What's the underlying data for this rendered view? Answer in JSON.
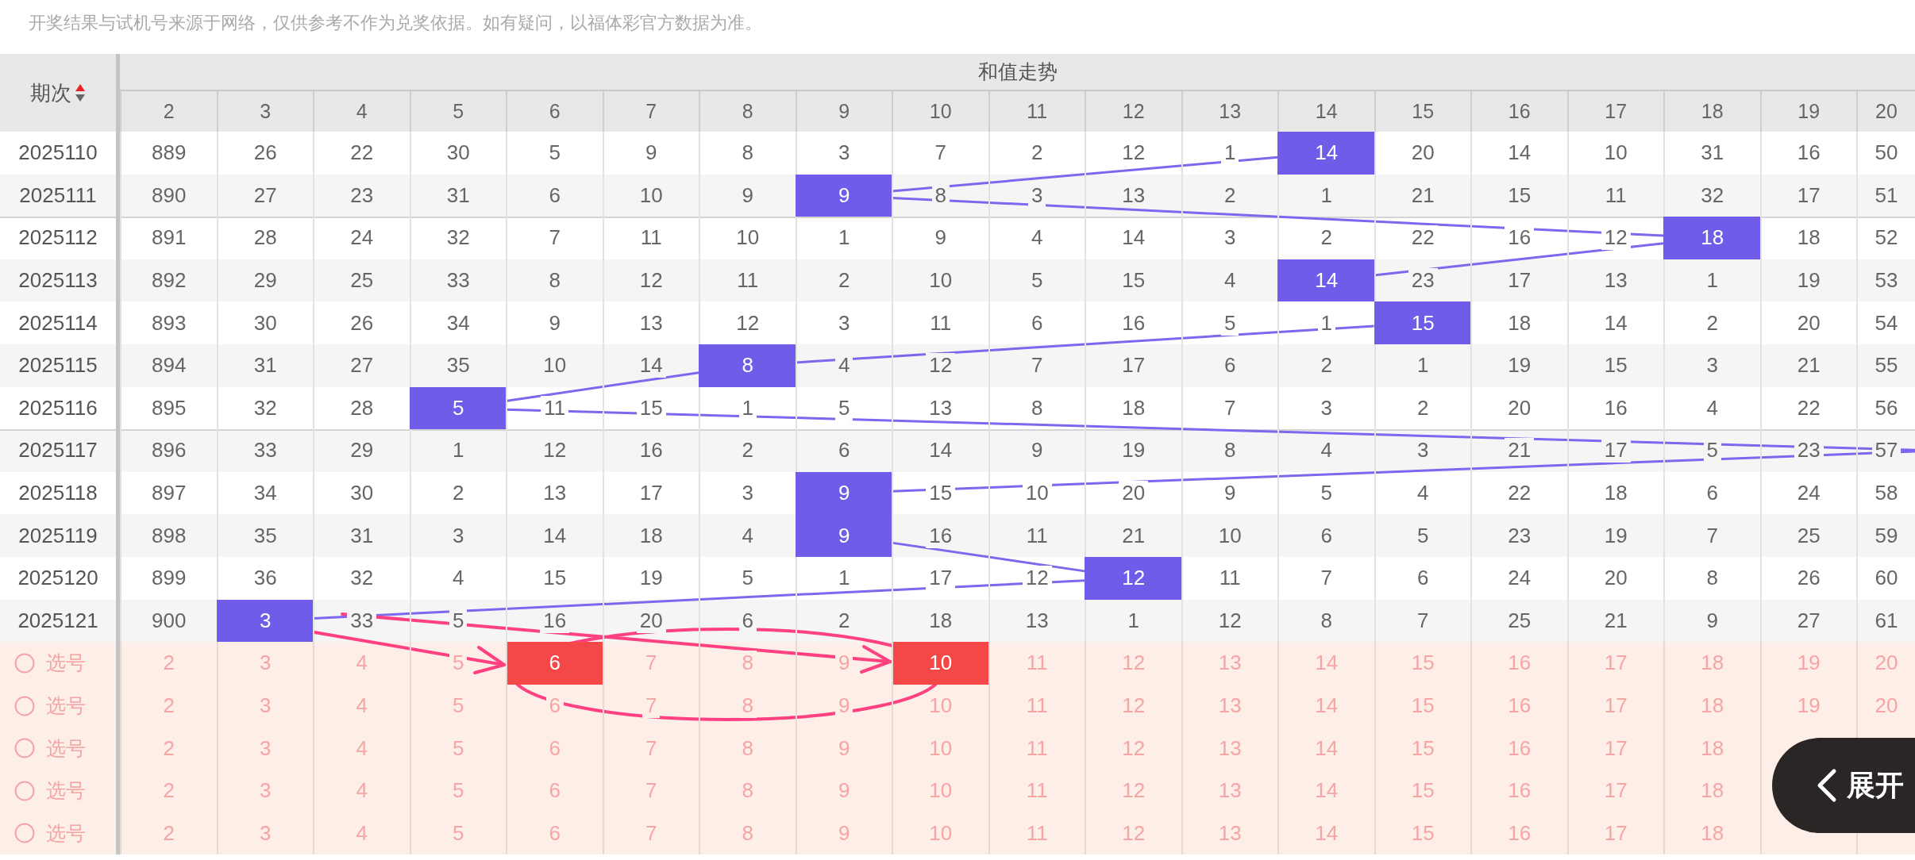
{
  "notice": "开奖结果与试机号来源于网络，仅供参考不作为兑奖依据。如有疑问，以福体彩官方数据为准。",
  "table": {
    "period_header": "期次",
    "sort_ascending": true,
    "group_header": "和值走势",
    "columns": [
      "2",
      "3",
      "4",
      "5",
      "6",
      "7",
      "8",
      "9",
      "10",
      "11",
      "12",
      "13",
      "14",
      "15",
      "16",
      "17",
      "18",
      "19",
      "20"
    ],
    "rows": [
      {
        "period": "2025110",
        "divider_above": false,
        "cells": [
          {
            "text": "889",
            "hit": false
          },
          {
            "text": "26",
            "hit": false
          },
          {
            "text": "22",
            "hit": false
          },
          {
            "text": "30",
            "hit": false
          },
          {
            "text": "5",
            "hit": false
          },
          {
            "text": "9",
            "hit": false
          },
          {
            "text": "8",
            "hit": false
          },
          {
            "text": "3",
            "hit": false
          },
          {
            "text": "7",
            "hit": false
          },
          {
            "text": "2",
            "hit": false
          },
          {
            "text": "12",
            "hit": false
          },
          {
            "text": "1",
            "hit": false
          },
          {
            "text": "14",
            "hit": true
          },
          {
            "text": "20",
            "hit": false
          },
          {
            "text": "14",
            "hit": false
          },
          {
            "text": "10",
            "hit": false
          },
          {
            "text": "31",
            "hit": false
          },
          {
            "text": "16",
            "hit": false
          },
          {
            "text": "50",
            "hit": false
          }
        ]
      },
      {
        "period": "2025111",
        "divider_above": false,
        "cells": [
          {
            "text": "890",
            "hit": false
          },
          {
            "text": "27",
            "hit": false
          },
          {
            "text": "23",
            "hit": false
          },
          {
            "text": "31",
            "hit": false
          },
          {
            "text": "6",
            "hit": false
          },
          {
            "text": "10",
            "hit": false
          },
          {
            "text": "9",
            "hit": false
          },
          {
            "text": "9",
            "hit": true
          },
          {
            "text": "8",
            "hit": false
          },
          {
            "text": "3",
            "hit": false
          },
          {
            "text": "13",
            "hit": false
          },
          {
            "text": "2",
            "hit": false
          },
          {
            "text": "1",
            "hit": false
          },
          {
            "text": "21",
            "hit": false
          },
          {
            "text": "15",
            "hit": false
          },
          {
            "text": "11",
            "hit": false
          },
          {
            "text": "32",
            "hit": false
          },
          {
            "text": "17",
            "hit": false
          },
          {
            "text": "51",
            "hit": false
          }
        ]
      },
      {
        "period": "2025112",
        "divider_above": true,
        "cells": [
          {
            "text": "891",
            "hit": false
          },
          {
            "text": "28",
            "hit": false
          },
          {
            "text": "24",
            "hit": false
          },
          {
            "text": "32",
            "hit": false
          },
          {
            "text": "7",
            "hit": false
          },
          {
            "text": "11",
            "hit": false
          },
          {
            "text": "10",
            "hit": false
          },
          {
            "text": "1",
            "hit": false
          },
          {
            "text": "9",
            "hit": false
          },
          {
            "text": "4",
            "hit": false
          },
          {
            "text": "14",
            "hit": false
          },
          {
            "text": "3",
            "hit": false
          },
          {
            "text": "2",
            "hit": false
          },
          {
            "text": "22",
            "hit": false
          },
          {
            "text": "16",
            "hit": false
          },
          {
            "text": "12",
            "hit": false
          },
          {
            "text": "18",
            "hit": true
          },
          {
            "text": "18",
            "hit": false
          },
          {
            "text": "52",
            "hit": false
          }
        ]
      },
      {
        "period": "2025113",
        "divider_above": false,
        "cells": [
          {
            "text": "892",
            "hit": false
          },
          {
            "text": "29",
            "hit": false
          },
          {
            "text": "25",
            "hit": false
          },
          {
            "text": "33",
            "hit": false
          },
          {
            "text": "8",
            "hit": false
          },
          {
            "text": "12",
            "hit": false
          },
          {
            "text": "11",
            "hit": false
          },
          {
            "text": "2",
            "hit": false
          },
          {
            "text": "10",
            "hit": false
          },
          {
            "text": "5",
            "hit": false
          },
          {
            "text": "15",
            "hit": false
          },
          {
            "text": "4",
            "hit": false
          },
          {
            "text": "14",
            "hit": true
          },
          {
            "text": "23",
            "hit": false
          },
          {
            "text": "17",
            "hit": false
          },
          {
            "text": "13",
            "hit": false
          },
          {
            "text": "1",
            "hit": false
          },
          {
            "text": "19",
            "hit": false
          },
          {
            "text": "53",
            "hit": false
          }
        ]
      },
      {
        "period": "2025114",
        "divider_above": false,
        "cells": [
          {
            "text": "893",
            "hit": false
          },
          {
            "text": "30",
            "hit": false
          },
          {
            "text": "26",
            "hit": false
          },
          {
            "text": "34",
            "hit": false
          },
          {
            "text": "9",
            "hit": false
          },
          {
            "text": "13",
            "hit": false
          },
          {
            "text": "12",
            "hit": false
          },
          {
            "text": "3",
            "hit": false
          },
          {
            "text": "11",
            "hit": false
          },
          {
            "text": "6",
            "hit": false
          },
          {
            "text": "16",
            "hit": false
          },
          {
            "text": "5",
            "hit": false
          },
          {
            "text": "1",
            "hit": false
          },
          {
            "text": "15",
            "hit": true
          },
          {
            "text": "18",
            "hit": false
          },
          {
            "text": "14",
            "hit": false
          },
          {
            "text": "2",
            "hit": false
          },
          {
            "text": "20",
            "hit": false
          },
          {
            "text": "54",
            "hit": false
          }
        ]
      },
      {
        "period": "2025115",
        "divider_above": false,
        "cells": [
          {
            "text": "894",
            "hit": false
          },
          {
            "text": "31",
            "hit": false
          },
          {
            "text": "27",
            "hit": false
          },
          {
            "text": "35",
            "hit": false
          },
          {
            "text": "10",
            "hit": false
          },
          {
            "text": "14",
            "hit": false
          },
          {
            "text": "8",
            "hit": true
          },
          {
            "text": "4",
            "hit": false
          },
          {
            "text": "12",
            "hit": false
          },
          {
            "text": "7",
            "hit": false
          },
          {
            "text": "17",
            "hit": false
          },
          {
            "text": "6",
            "hit": false
          },
          {
            "text": "2",
            "hit": false
          },
          {
            "text": "1",
            "hit": false
          },
          {
            "text": "19",
            "hit": false
          },
          {
            "text": "15",
            "hit": false
          },
          {
            "text": "3",
            "hit": false
          },
          {
            "text": "21",
            "hit": false
          },
          {
            "text": "55",
            "hit": false
          }
        ]
      },
      {
        "period": "2025116",
        "divider_above": false,
        "cells": [
          {
            "text": "895",
            "hit": false
          },
          {
            "text": "32",
            "hit": false
          },
          {
            "text": "28",
            "hit": false
          },
          {
            "text": "5",
            "hit": true
          },
          {
            "text": "11",
            "hit": false
          },
          {
            "text": "15",
            "hit": false
          },
          {
            "text": "1",
            "hit": false
          },
          {
            "text": "5",
            "hit": false
          },
          {
            "text": "13",
            "hit": false
          },
          {
            "text": "8",
            "hit": false
          },
          {
            "text": "18",
            "hit": false
          },
          {
            "text": "7",
            "hit": false
          },
          {
            "text": "3",
            "hit": false
          },
          {
            "text": "2",
            "hit": false
          },
          {
            "text": "20",
            "hit": false
          },
          {
            "text": "16",
            "hit": false
          },
          {
            "text": "4",
            "hit": false
          },
          {
            "text": "22",
            "hit": false
          },
          {
            "text": "56",
            "hit": false
          }
        ]
      },
      {
        "period": "2025117",
        "divider_above": true,
        "cells": [
          {
            "text": "896",
            "hit": false
          },
          {
            "text": "33",
            "hit": false
          },
          {
            "text": "29",
            "hit": false
          },
          {
            "text": "1",
            "hit": false
          },
          {
            "text": "12",
            "hit": false
          },
          {
            "text": "16",
            "hit": false
          },
          {
            "text": "2",
            "hit": false
          },
          {
            "text": "6",
            "hit": false
          },
          {
            "text": "14",
            "hit": false
          },
          {
            "text": "9",
            "hit": false
          },
          {
            "text": "19",
            "hit": false
          },
          {
            "text": "8",
            "hit": false
          },
          {
            "text": "4",
            "hit": false
          },
          {
            "text": "3",
            "hit": false
          },
          {
            "text": "21",
            "hit": false
          },
          {
            "text": "17",
            "hit": false
          },
          {
            "text": "5",
            "hit": false
          },
          {
            "text": "23",
            "hit": false
          },
          {
            "text": "57",
            "hit": false
          }
        ]
      },
      {
        "period": "2025118",
        "divider_above": false,
        "cells": [
          {
            "text": "897",
            "hit": false
          },
          {
            "text": "34",
            "hit": false
          },
          {
            "text": "30",
            "hit": false
          },
          {
            "text": "2",
            "hit": false
          },
          {
            "text": "13",
            "hit": false
          },
          {
            "text": "17",
            "hit": false
          },
          {
            "text": "3",
            "hit": false
          },
          {
            "text": "9",
            "hit": true
          },
          {
            "text": "15",
            "hit": false
          },
          {
            "text": "10",
            "hit": false
          },
          {
            "text": "20",
            "hit": false
          },
          {
            "text": "9",
            "hit": false
          },
          {
            "text": "5",
            "hit": false
          },
          {
            "text": "4",
            "hit": false
          },
          {
            "text": "22",
            "hit": false
          },
          {
            "text": "18",
            "hit": false
          },
          {
            "text": "6",
            "hit": false
          },
          {
            "text": "24",
            "hit": false
          },
          {
            "text": "58",
            "hit": false
          }
        ]
      },
      {
        "period": "2025119",
        "divider_above": false,
        "cells": [
          {
            "text": "898",
            "hit": false
          },
          {
            "text": "35",
            "hit": false
          },
          {
            "text": "31",
            "hit": false
          },
          {
            "text": "3",
            "hit": false
          },
          {
            "text": "14",
            "hit": false
          },
          {
            "text": "18",
            "hit": false
          },
          {
            "text": "4",
            "hit": false
          },
          {
            "text": "9",
            "hit": true
          },
          {
            "text": "16",
            "hit": false
          },
          {
            "text": "11",
            "hit": false
          },
          {
            "text": "21",
            "hit": false
          },
          {
            "text": "10",
            "hit": false
          },
          {
            "text": "6",
            "hit": false
          },
          {
            "text": "5",
            "hit": false
          },
          {
            "text": "23",
            "hit": false
          },
          {
            "text": "19",
            "hit": false
          },
          {
            "text": "7",
            "hit": false
          },
          {
            "text": "25",
            "hit": false
          },
          {
            "text": "59",
            "hit": false
          }
        ]
      },
      {
        "period": "2025120",
        "divider_above": false,
        "cells": [
          {
            "text": "899",
            "hit": false
          },
          {
            "text": "36",
            "hit": false
          },
          {
            "text": "32",
            "hit": false
          },
          {
            "text": "4",
            "hit": false
          },
          {
            "text": "15",
            "hit": false
          },
          {
            "text": "19",
            "hit": false
          },
          {
            "text": "5",
            "hit": false
          },
          {
            "text": "1",
            "hit": false
          },
          {
            "text": "17",
            "hit": false
          },
          {
            "text": "12",
            "hit": false
          },
          {
            "text": "12",
            "hit": true
          },
          {
            "text": "11",
            "hit": false
          },
          {
            "text": "7",
            "hit": false
          },
          {
            "text": "6",
            "hit": false
          },
          {
            "text": "24",
            "hit": false
          },
          {
            "text": "20",
            "hit": false
          },
          {
            "text": "8",
            "hit": false
          },
          {
            "text": "26",
            "hit": false
          },
          {
            "text": "60",
            "hit": false
          }
        ]
      },
      {
        "period": "2025121",
        "divider_above": false,
        "cells": [
          {
            "text": "900",
            "hit": false
          },
          {
            "text": "3",
            "hit": true
          },
          {
            "text": "33",
            "hit": false
          },
          {
            "text": "5",
            "hit": false
          },
          {
            "text": "16",
            "hit": false
          },
          {
            "text": "20",
            "hit": false
          },
          {
            "text": "6",
            "hit": false
          },
          {
            "text": "2",
            "hit": false
          },
          {
            "text": "18",
            "hit": false
          },
          {
            "text": "13",
            "hit": false
          },
          {
            "text": "1",
            "hit": false
          },
          {
            "text": "12",
            "hit": false
          },
          {
            "text": "8",
            "hit": false
          },
          {
            "text": "7",
            "hit": false
          },
          {
            "text": "25",
            "hit": false
          },
          {
            "text": "21",
            "hit": false
          },
          {
            "text": "9",
            "hit": false
          },
          {
            "text": "27",
            "hit": false
          },
          {
            "text": "61",
            "hit": false
          }
        ]
      }
    ],
    "pick_rows": [
      {
        "label": "选号",
        "cells": [
          {
            "text": "2",
            "selected": false
          },
          {
            "text": "3",
            "selected": false
          },
          {
            "text": "4",
            "selected": false
          },
          {
            "text": "5",
            "selected": false
          },
          {
            "text": "6",
            "selected": true
          },
          {
            "text": "7",
            "selected": false
          },
          {
            "text": "8",
            "selected": false
          },
          {
            "text": "9",
            "selected": false
          },
          {
            "text": "10",
            "selected": true
          },
          {
            "text": "11",
            "selected": false
          },
          {
            "text": "12",
            "selected": false
          },
          {
            "text": "13",
            "selected": false
          },
          {
            "text": "14",
            "selected": false
          },
          {
            "text": "15",
            "selected": false
          },
          {
            "text": "16",
            "selected": false
          },
          {
            "text": "17",
            "selected": false
          },
          {
            "text": "18",
            "selected": false
          },
          {
            "text": "19",
            "selected": false
          },
          {
            "text": "20",
            "selected": false
          }
        ]
      },
      {
        "label": "选号",
        "cells": [
          {
            "text": "2",
            "selected": false
          },
          {
            "text": "3",
            "selected": false
          },
          {
            "text": "4",
            "selected": false
          },
          {
            "text": "5",
            "selected": false
          },
          {
            "text": "6",
            "selected": false
          },
          {
            "text": "7",
            "selected": false
          },
          {
            "text": "8",
            "selected": false
          },
          {
            "text": "9",
            "selected": false
          },
          {
            "text": "10",
            "selected": false
          },
          {
            "text": "11",
            "selected": false
          },
          {
            "text": "12",
            "selected": false
          },
          {
            "text": "13",
            "selected": false
          },
          {
            "text": "14",
            "selected": false
          },
          {
            "text": "15",
            "selected": false
          },
          {
            "text": "16",
            "selected": false
          },
          {
            "text": "17",
            "selected": false
          },
          {
            "text": "18",
            "selected": false
          },
          {
            "text": "19",
            "selected": false
          },
          {
            "text": "20",
            "selected": false
          }
        ]
      },
      {
        "label": "选号",
        "cells": [
          {
            "text": "2",
            "selected": false
          },
          {
            "text": "3",
            "selected": false
          },
          {
            "text": "4",
            "selected": false
          },
          {
            "text": "5",
            "selected": false
          },
          {
            "text": "6",
            "selected": false
          },
          {
            "text": "7",
            "selected": false
          },
          {
            "text": "8",
            "selected": false
          },
          {
            "text": "9",
            "selected": false
          },
          {
            "text": "10",
            "selected": false
          },
          {
            "text": "11",
            "selected": false
          },
          {
            "text": "12",
            "selected": false
          },
          {
            "text": "13",
            "selected": false
          },
          {
            "text": "14",
            "selected": false
          },
          {
            "text": "15",
            "selected": false
          },
          {
            "text": "16",
            "selected": false
          },
          {
            "text": "17",
            "selected": false
          },
          {
            "text": "18",
            "selected": false
          }
        ]
      },
      {
        "label": "选号",
        "cells": [
          {
            "text": "2",
            "selected": false
          },
          {
            "text": "3",
            "selected": false
          },
          {
            "text": "4",
            "selected": false
          },
          {
            "text": "5",
            "selected": false
          },
          {
            "text": "6",
            "selected": false
          },
          {
            "text": "7",
            "selected": false
          },
          {
            "text": "8",
            "selected": false
          },
          {
            "text": "9",
            "selected": false
          },
          {
            "text": "10",
            "selected": false
          },
          {
            "text": "11",
            "selected": false
          },
          {
            "text": "12",
            "selected": false
          },
          {
            "text": "13",
            "selected": false
          },
          {
            "text": "14",
            "selected": false
          },
          {
            "text": "15",
            "selected": false
          },
          {
            "text": "16",
            "selected": false
          },
          {
            "text": "17",
            "selected": false
          },
          {
            "text": "18",
            "selected": false
          }
        ]
      },
      {
        "label": "选号",
        "cells": [
          {
            "text": "2",
            "selected": false
          },
          {
            "text": "3",
            "selected": false
          },
          {
            "text": "4",
            "selected": false
          },
          {
            "text": "5",
            "selected": false
          },
          {
            "text": "6",
            "selected": false
          },
          {
            "text": "7",
            "selected": false
          },
          {
            "text": "8",
            "selected": false
          },
          {
            "text": "9",
            "selected": false
          },
          {
            "text": "10",
            "selected": false
          },
          {
            "text": "11",
            "selected": false
          },
          {
            "text": "12",
            "selected": false
          },
          {
            "text": "13",
            "selected": false
          },
          {
            "text": "14",
            "selected": false
          },
          {
            "text": "15",
            "selected": false
          },
          {
            "text": "16",
            "selected": false
          },
          {
            "text": "17",
            "selected": false
          },
          {
            "text": "18",
            "selected": false
          }
        ]
      }
    ]
  },
  "expand_button": {
    "label": "展开"
  }
}
